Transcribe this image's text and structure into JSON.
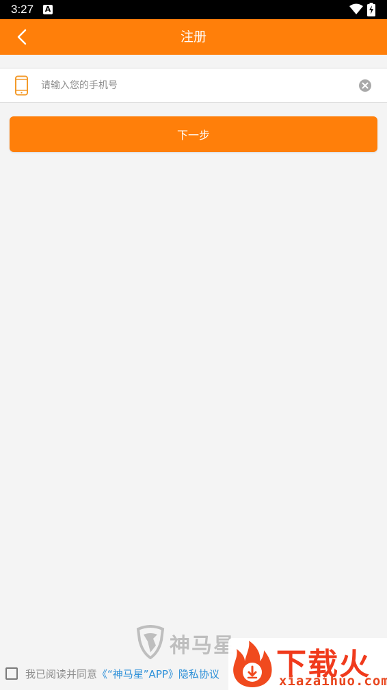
{
  "status_bar": {
    "time": "3:27",
    "notification_icon": "A"
  },
  "app_bar": {
    "title": "注册",
    "back_icon": "chevron-left-icon"
  },
  "phone_field": {
    "placeholder": "请输入您的手机号",
    "value": "",
    "icon": "phone-icon",
    "clear_icon": "clear-icon"
  },
  "next_button": {
    "label": "下一步"
  },
  "brand": {
    "name": "神马星"
  },
  "agreement": {
    "prefix": "我已阅读并同意",
    "link": "《“神马星”APP》隐私协议",
    "checked": false
  },
  "watermark": {
    "text": "下载火",
    "url": "xiazaihuo.com"
  },
  "colors": {
    "accent": "#ff7f0a",
    "link": "#2b8fd8",
    "background": "#f4f4f4",
    "watermark": "#f03a1c"
  }
}
